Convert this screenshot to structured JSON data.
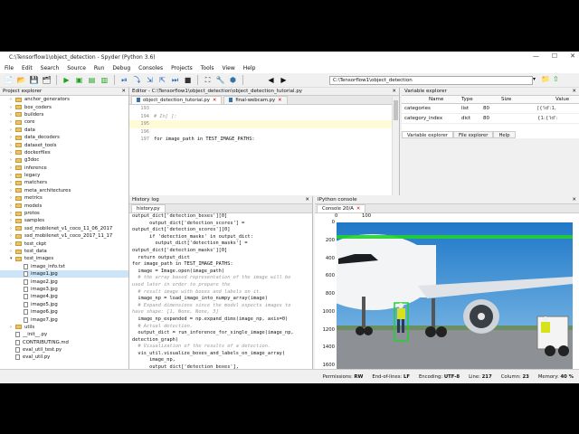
{
  "window": {
    "title": "C:\\Tensorflow1\\object_detection - Spyder (Python 3.6)",
    "controls": [
      "—",
      "☐",
      "✕"
    ]
  },
  "menu": [
    "File",
    "Edit",
    "Search",
    "Source",
    "Run",
    "Debug",
    "Consoles",
    "Projects",
    "Tools",
    "View",
    "Help"
  ],
  "toolbar": {
    "path": "C:\\Tensorflow1\\object_detection"
  },
  "project_explorer": {
    "title": "Project explorer",
    "items": [
      {
        "label": "anchor_generators",
        "type": "folder",
        "indent": 1
      },
      {
        "label": "box_coders",
        "type": "folder",
        "indent": 1
      },
      {
        "label": "builders",
        "type": "folder",
        "indent": 1
      },
      {
        "label": "core",
        "type": "folder",
        "indent": 1
      },
      {
        "label": "data",
        "type": "folder",
        "indent": 1
      },
      {
        "label": "data_decoders",
        "type": "folder",
        "indent": 1
      },
      {
        "label": "dataset_tools",
        "type": "folder",
        "indent": 1
      },
      {
        "label": "dockerfiles",
        "type": "folder",
        "indent": 1
      },
      {
        "label": "g3doc",
        "type": "folder",
        "indent": 1
      },
      {
        "label": "inference",
        "type": "folder",
        "indent": 1
      },
      {
        "label": "legacy",
        "type": "folder",
        "indent": 1
      },
      {
        "label": "matchers",
        "type": "folder",
        "indent": 1
      },
      {
        "label": "meta_architectures",
        "type": "folder",
        "indent": 1
      },
      {
        "label": "metrics",
        "type": "folder",
        "indent": 1
      },
      {
        "label": "models",
        "type": "folder",
        "indent": 1
      },
      {
        "label": "protos",
        "type": "folder",
        "indent": 1
      },
      {
        "label": "samples",
        "type": "folder",
        "indent": 1
      },
      {
        "label": "ssd_mobilenet_v1_coco_11_06_2017",
        "type": "folder",
        "indent": 1
      },
      {
        "label": "ssd_mobilenet_v1_coco_2017_11_17",
        "type": "folder",
        "indent": 1
      },
      {
        "label": "test_ckpt",
        "type": "folder",
        "indent": 1
      },
      {
        "label": "test_data",
        "type": "folder",
        "indent": 1
      },
      {
        "label": "test_images",
        "type": "folder-open",
        "indent": 1
      },
      {
        "label": "image_info.txt",
        "type": "file",
        "indent": 2
      },
      {
        "label": "image1.jpg",
        "type": "file",
        "indent": 2,
        "selected": true
      },
      {
        "label": "image2.jpg",
        "type": "file",
        "indent": 2
      },
      {
        "label": "image3.jpg",
        "type": "file",
        "indent": 2
      },
      {
        "label": "image4.jpg",
        "type": "file",
        "indent": 2
      },
      {
        "label": "image5.jpg",
        "type": "file",
        "indent": 2
      },
      {
        "label": "image6.jpg",
        "type": "file",
        "indent": 2
      },
      {
        "label": "image7.jpg",
        "type": "file",
        "indent": 2
      },
      {
        "label": "utils",
        "type": "folder",
        "indent": 1
      },
      {
        "label": "__init__.py",
        "type": "file",
        "indent": 1
      },
      {
        "label": "CONTRIBUTING.md",
        "type": "file",
        "indent": 1
      },
      {
        "label": "eval_util_test.py",
        "type": "file",
        "indent": 1
      },
      {
        "label": "eval_util.py",
        "type": "file",
        "indent": 1
      }
    ]
  },
  "editor": {
    "title": "Editor - C:\\Tensorflow1\\object_detection\\object_detection_tutorial.py",
    "tabs": [
      {
        "label": "object_detection_tutorial.py",
        "active": true
      },
      {
        "label": "final-webcam.py",
        "active": false
      }
    ],
    "lines": [
      {
        "num": "193",
        "text": "",
        "kind": "plain"
      },
      {
        "num": "194",
        "text": "# In[ ]:",
        "kind": "comment"
      },
      {
        "num": "195",
        "text": "",
        "kind": "plain"
      },
      {
        "num": "196",
        "text": "",
        "kind": "plain"
      },
      {
        "num": "197",
        "text": "for image_path in TEST_IMAGE_PATHS:",
        "kind": "code"
      }
    ]
  },
  "variable_explorer": {
    "title": "Variable explorer",
    "columns": [
      "Name",
      "Type",
      "Size",
      "Value"
    ],
    "rows": [
      {
        "name": "categories",
        "type": "list",
        "size": "80",
        "value": "[{'id':1,"
      },
      {
        "name": "category_index",
        "type": "dict",
        "size": "80",
        "value": "{1:{'id':"
      }
    ],
    "tabs": [
      "Variable explorer",
      "File explorer",
      "Help"
    ]
  },
  "history": {
    "title": "History log",
    "tab": "history.py",
    "lines": [
      {
        "text": "output_dict['detection_boxes'][0]",
        "kind": "code"
      },
      {
        "text": "      output_dict['detection_scores'] =",
        "kind": "code"
      },
      {
        "text": "output_dict['detection_scores'][0]",
        "kind": "code"
      },
      {
        "text": "      if 'detection_masks' in output_dict:",
        "kind": "code"
      },
      {
        "text": "        output_dict['detection_masks'] =",
        "kind": "code"
      },
      {
        "text": "output_dict['detection_masks'][0]",
        "kind": "code"
      },
      {
        "text": "  return output_dict",
        "kind": "code"
      },
      {
        "text": "for image_path in TEST_IMAGE_PATHS:",
        "kind": "code"
      },
      {
        "text": "  image = Image.open(image_path)",
        "kind": "code"
      },
      {
        "text": "  # the array based representation of the image will be",
        "kind": "comment"
      },
      {
        "text": "used later in order to prepare the",
        "kind": "comment"
      },
      {
        "text": "  # result image with boxes and labels on it.",
        "kind": "comment"
      },
      {
        "text": "  image_np = load_image_into_numpy_array(image)",
        "kind": "code"
      },
      {
        "text": "  # Expand dimensions since the model expects images to",
        "kind": "comment"
      },
      {
        "text": "have shape: [1, None, None, 3]",
        "kind": "comment"
      },
      {
        "text": "  image_np_expanded = np.expand_dims(image_np, axis=0)",
        "kind": "code"
      },
      {
        "text": "  # Actual detection.",
        "kind": "comment"
      },
      {
        "text": "  output_dict = run_inference_for_single_image(image_np,",
        "kind": "code"
      },
      {
        "text": "detection_graph)",
        "kind": "code"
      },
      {
        "text": "  # Visualization of the results of a detection.",
        "kind": "comment"
      },
      {
        "text": "  vis_util.visualize_boxes_and_labels_on_image_array(",
        "kind": "code"
      },
      {
        "text": "      image_np,",
        "kind": "code"
      },
      {
        "text": "      output_dict['detection_boxes'],",
        "kind": "code"
      },
      {
        "text": "      output_dict['detection_classes'],",
        "kind": "code"
      },
      {
        "text": "      output_dict['detection_scores'],",
        "kind": "code"
      },
      {
        "text": "      category_index,",
        "kind": "code"
      },
      {
        "text": "      instance_masks=output_dict.get('detection_masks'),",
        "kind": "code"
      },
      {
        "text": "      use_normalized_coordinates=True,",
        "kind": "code"
      },
      {
        "text": "      line_thickness=8)",
        "kind": "code"
      },
      {
        "text": "  plt.figure(figsize=IMAGE_SIZE)",
        "kind": "code"
      },
      {
        "text": "  plt.imshow(image_np)",
        "kind": "code-hl"
      }
    ]
  },
  "console": {
    "title": "IPython console",
    "tab": "Console 20/A",
    "x_ticks": [
      "0",
      "100"
    ],
    "y_ticks": [
      "0",
      "200",
      "400",
      "600",
      "800",
      "1000",
      "1200",
      "1400",
      "1600"
    ]
  },
  "statusbar": {
    "permissions_label": "Permissions:",
    "permissions": "RW",
    "eol_label": "End-of-lines:",
    "eol": "LF",
    "encoding_label": "Encoding:",
    "encoding": "UTF-8",
    "line_label": "Line:",
    "line": "217",
    "column_label": "Column:",
    "column": "23",
    "memory_label": "Memory:",
    "memory": "40 %"
  }
}
